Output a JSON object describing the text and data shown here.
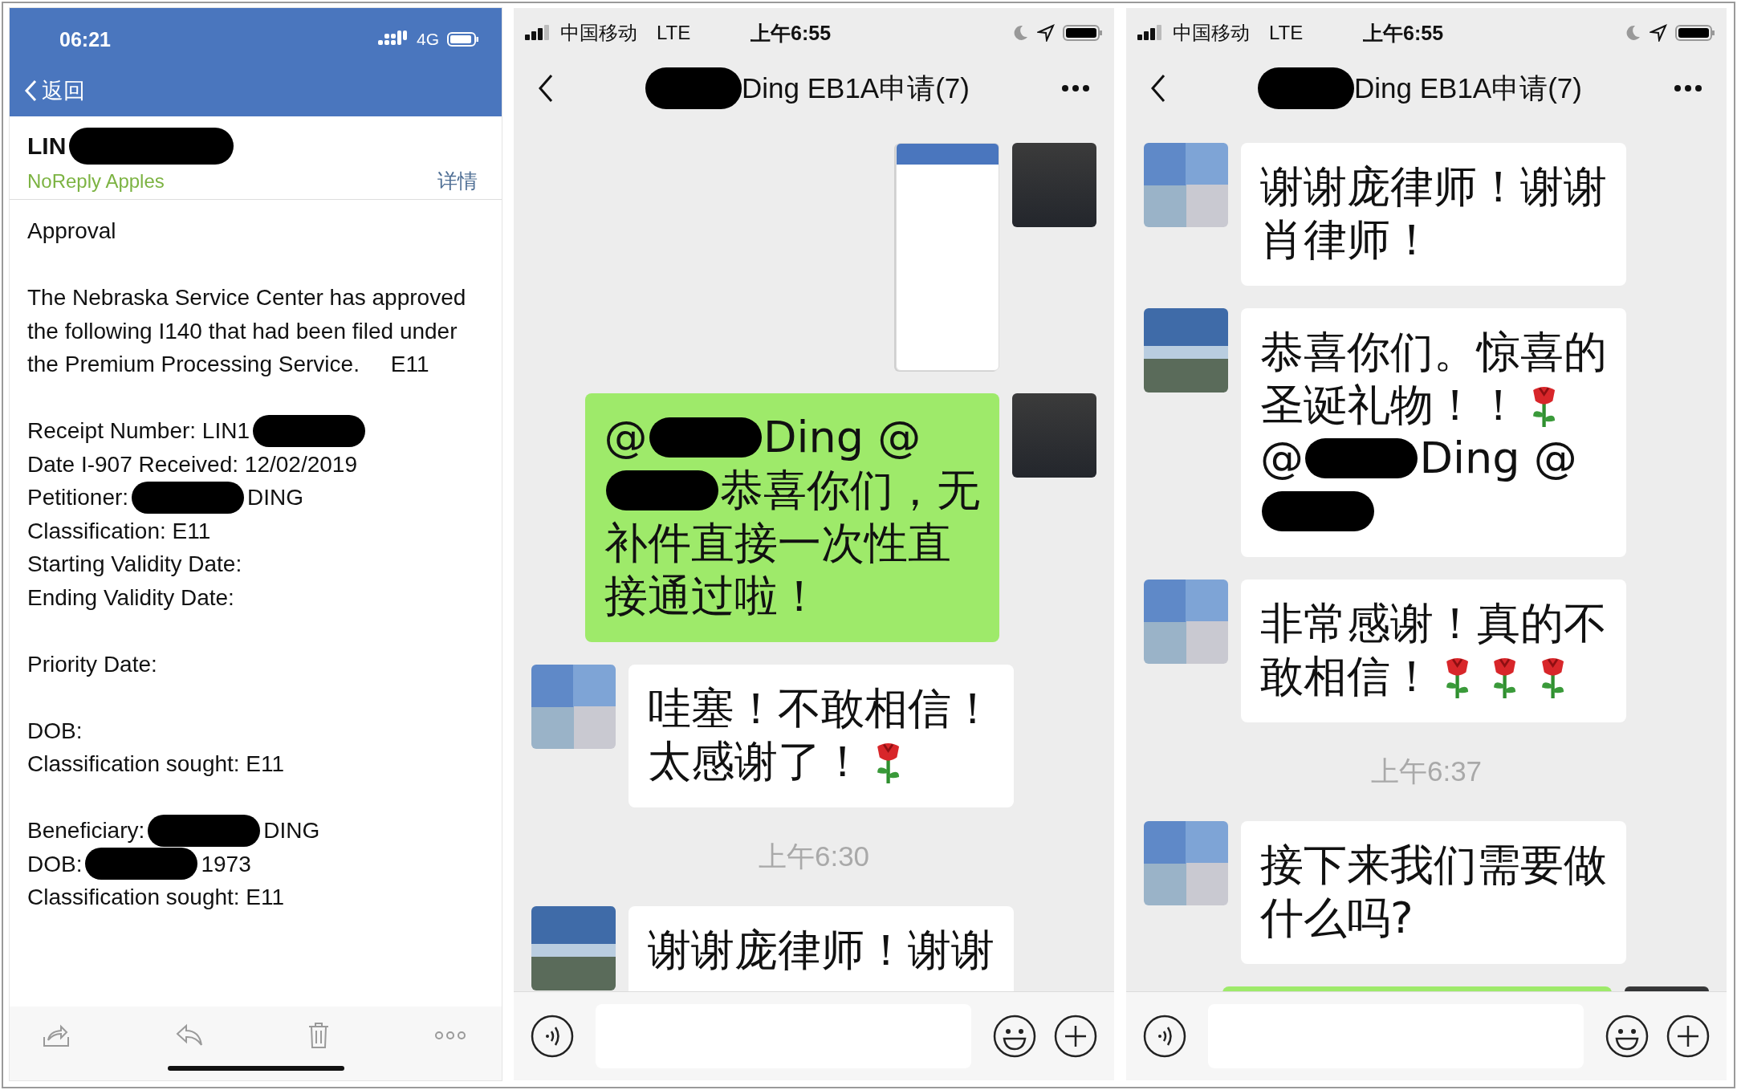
{
  "email": {
    "status_time": "06:21",
    "network": "4G",
    "back_label": "返回",
    "subject": [
      "LIN",
      {
        "kind": "redaction"
      }
    ],
    "sender": "NoReply Apples",
    "details_link": "详情",
    "paragraphs": [
      [
        "Approval"
      ],
      [
        "The Nebraska Service Center has approved",
        "the following I140 that had been filed under",
        "the Premium Processing Service.     E11"
      ],
      [
        [
          "Receipt Number: LIN1",
          {
            "kind": "redaction"
          }
        ],
        "Date I-907 Received: 12/02/2019",
        [
          "Petitioner:",
          {
            "kind": "redaction"
          },
          "DING"
        ],
        "Classification: E11",
        "Starting Validity Date:",
        "Ending Validity Date:"
      ],
      [
        "Priority Date:"
      ],
      [
        "DOB:",
        "Classification sought: E11"
      ],
      [
        [
          "Beneficiary:",
          {
            "kind": "redaction"
          },
          "DING"
        ],
        [
          "DOB:",
          {
            "kind": "redaction"
          },
          "1973"
        ],
        "Classification sought: E11"
      ]
    ]
  },
  "chats": [
    {
      "carrier": "中国移动",
      "network": "LTE",
      "time": "上午6:55",
      "title": [
        {
          "kind": "redaction"
        },
        "Ding EB1A申请(7)"
      ],
      "messages": [
        {
          "kind": "image",
          "outgoing": true,
          "avatar": {
            "kind": "portrait"
          }
        },
        {
          "kind": "text",
          "outgoing": true,
          "avatar": {
            "kind": "portrait"
          },
          "lines": [
            [
              "@",
              {
                "kind": "redaction"
              },
              "Ding @"
            ],
            [
              {
                "kind": "redaction"
              },
              "恭喜你们，无"
            ],
            [
              "补件直接一次性直"
            ],
            [
              "接通过啦！"
            ]
          ]
        },
        {
          "kind": "text",
          "outgoing": false,
          "avatar": {
            "kind": "mosaic"
          },
          "lines": [
            [
              "哇塞！不敢相信！"
            ],
            [
              "太感谢了！",
              {
                "kind": "rose"
              }
            ]
          ]
        },
        {
          "kind": "time",
          "text": "上午6:30"
        },
        {
          "kind": "text",
          "outgoing": false,
          "avatar": {
            "kind": "landscape"
          },
          "lines": [
            [
              "谢谢庞律师！谢谢"
            ]
          ]
        }
      ]
    },
    {
      "carrier": "中国移动",
      "network": "LTE",
      "time": "上午6:55",
      "title": [
        {
          "kind": "redaction"
        },
        "Ding EB1A申请(7)"
      ],
      "messages": [
        {
          "kind": "text",
          "outgoing": false,
          "avatar": {
            "kind": "mosaic"
          },
          "lines": [
            [
              "谢谢庞律师！谢谢"
            ],
            [
              "肖律师！"
            ]
          ]
        },
        {
          "kind": "text",
          "outgoing": false,
          "avatar": {
            "kind": "landscape"
          },
          "lines": [
            [
              "恭喜你们。惊喜的"
            ],
            [
              "圣诞礼物！！",
              {
                "kind": "rose"
              }
            ],
            [
              "@",
              {
                "kind": "redaction"
              },
              "Ding @"
            ],
            [
              {
                "kind": "redaction"
              }
            ]
          ]
        },
        {
          "kind": "text",
          "outgoing": false,
          "avatar": {
            "kind": "mosaic"
          },
          "lines": [
            [
              "非常感谢！真的不"
            ],
            [
              "敢相信！",
              {
                "kind": "rose"
              },
              {
                "kind": "rose"
              },
              {
                "kind": "rose"
              }
            ]
          ]
        },
        {
          "kind": "time",
          "text": "上午6:37"
        },
        {
          "kind": "text",
          "outgoing": false,
          "avatar": {
            "kind": "mosaic"
          },
          "lines": [
            [
              "接下来我们需要做"
            ],
            [
              "什么吗?"
            ]
          ]
        },
        {
          "kind": "clipped",
          "outgoing": true,
          "avatar": {
            "kind": "portrait"
          }
        }
      ]
    }
  ]
}
